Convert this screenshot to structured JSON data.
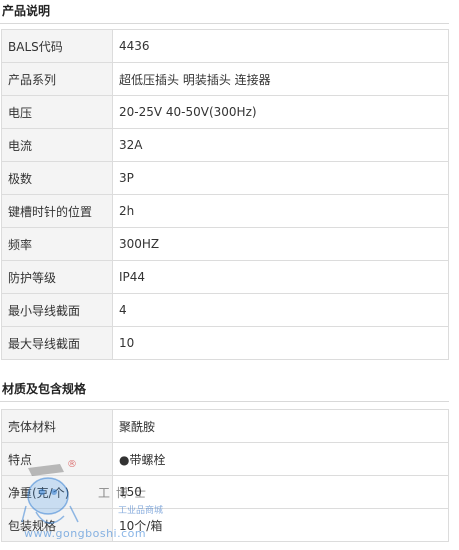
{
  "section1": {
    "title": "产品说明",
    "rows": [
      {
        "label": "BALS代码",
        "value": "4436"
      },
      {
        "label": "产品系列",
        "value": "超低压插头 明装插头 连接器"
      },
      {
        "label": "电压",
        "value": "20-25V 40-50V(300Hz)"
      },
      {
        "label": "电流",
        "value": "32A"
      },
      {
        "label": "极数",
        "value": "3P"
      },
      {
        "label": "键槽时针的位置",
        "value": "2h"
      },
      {
        "label": "频率",
        "value": "300HZ"
      },
      {
        "label": "防护等级",
        "value": "IP44"
      },
      {
        "label": "最小导线截面",
        "value": "4"
      },
      {
        "label": "最大导线截面",
        "value": "10"
      }
    ]
  },
  "section2": {
    "title": "材质及包含规格",
    "rows": [
      {
        "label": "壳体材料",
        "value": "聚酰胺"
      },
      {
        "label": "特点",
        "value": "●带螺栓"
      },
      {
        "label": "净重(克/个)",
        "value": "150"
      },
      {
        "label": "包装规格",
        "value": "10个/箱"
      }
    ]
  },
  "watermark": {
    "brand": "工博士",
    "subtitle": "工业品商城",
    "url": "www.gongboshi.com",
    "registered": "®"
  }
}
